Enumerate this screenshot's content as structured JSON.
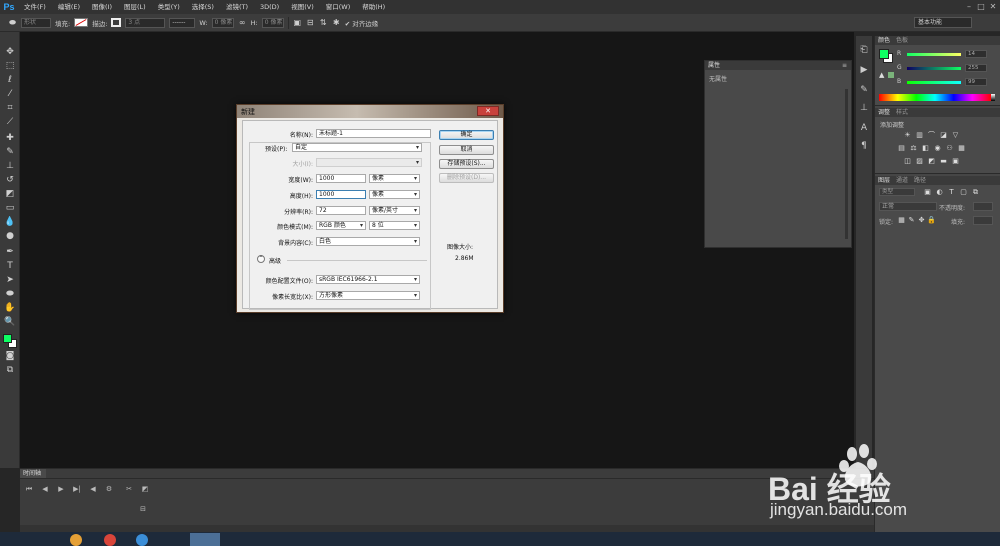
{
  "app": {
    "logo": "Ps"
  },
  "menubar": {
    "items": [
      "文件(F)",
      "编辑(E)",
      "图像(I)",
      "图层(L)",
      "类型(Y)",
      "选择(S)",
      "滤镜(T)",
      "3D(D)",
      "视图(V)",
      "窗口(W)",
      "帮助(H)"
    ]
  },
  "options_bar": {
    "style_label": "形状",
    "fill_label": "填充:",
    "stroke_label": "描边:",
    "stroke_width": "3 点",
    "w_label": "W:",
    "w_value": "0 像素",
    "h_label": "H:",
    "h_value": "0 像素",
    "align_edges_label": "对齐边缘",
    "workspace": "基本功能"
  },
  "properties_panel": {
    "tab": "属性",
    "content": "无属性"
  },
  "color_panel": {
    "tabs": [
      "颜色",
      "色板"
    ],
    "r_label": "R",
    "r_value": "14",
    "g_label": "G",
    "g_value": "255",
    "b_label": "B",
    "b_value": "99",
    "foreground_color": "#0eff63",
    "background_color": "#ffffff"
  },
  "adjustments_panel": {
    "tabs": [
      "调整",
      "样式"
    ],
    "title": "添加调整"
  },
  "layers_panel": {
    "tabs": [
      "图层",
      "通道",
      "路径"
    ],
    "kind_label": "类型",
    "blend_mode": "正常",
    "opacity_label": "不透明度:",
    "lock_label": "锁定:",
    "fill_label": "填充:"
  },
  "timeline": {
    "tab": "时间轴"
  },
  "dialog": {
    "title": "新建",
    "close_glyph": "✕",
    "name_label": "名称(N):",
    "name_value": "未标题-1",
    "preset_label": "预设(P):",
    "preset_value": "自定",
    "size_label": "大小(I):",
    "size_value": "",
    "width_label": "宽度(W):",
    "width_value": "1000",
    "width_unit": "像素",
    "height_label": "高度(H):",
    "height_value": "1000",
    "height_unit": "像素",
    "resolution_label": "分辨率(R):",
    "resolution_value": "72",
    "resolution_unit": "像素/英寸",
    "color_mode_label": "颜色模式(M):",
    "color_mode_value": "RGB 颜色",
    "bit_depth_value": "8 位",
    "bg_label": "背景内容(C):",
    "bg_value": "白色",
    "advanced_label": "高级",
    "profile_label": "颜色配置文件(O):",
    "profile_value": "sRGB IEC61966-2.1",
    "pixel_aspect_label": "像素长宽比(X):",
    "pixel_aspect_value": "方形像素",
    "ok_button": "确定",
    "cancel_button": "取消",
    "save_preset_button": "存储预设(S)...",
    "delete_preset_button": "删除预设(D)...",
    "image_size_label": "图像大小:",
    "image_size_value": "2.86M"
  },
  "watermark": {
    "brand": "Bai 经验",
    "url": "jingyan.baidu.com"
  }
}
